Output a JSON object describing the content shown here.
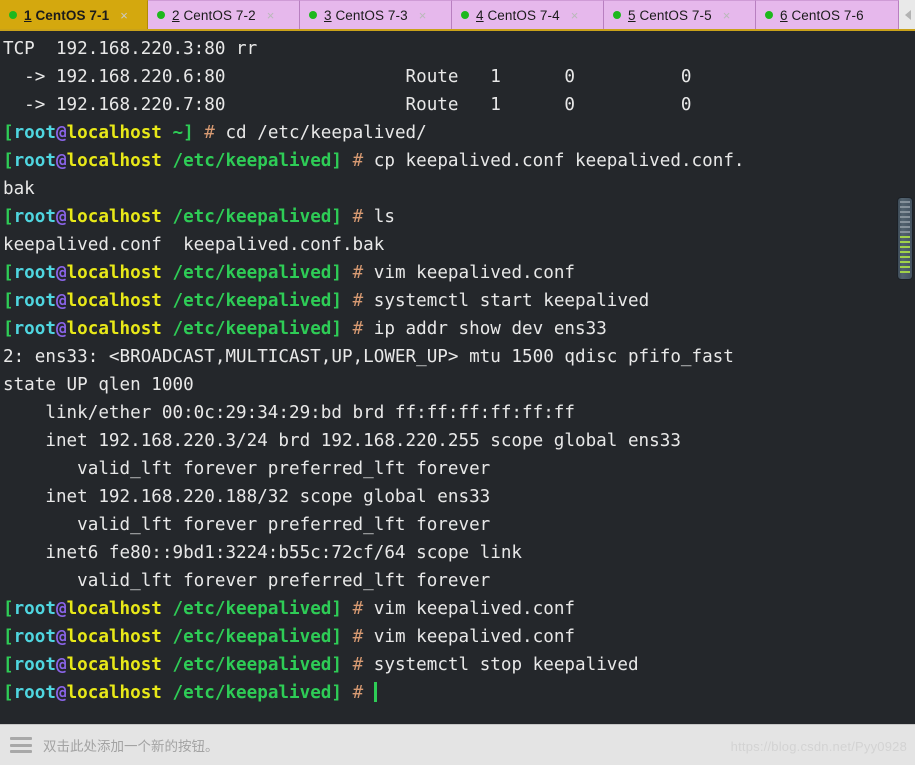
{
  "window": {
    "accent_active_tab": "#d4a80e",
    "accent_inactive_tab": "#e6b8ec",
    "terminal_background": "#24272b"
  },
  "tabbar": {
    "tabs": [
      {
        "num": "1",
        "name": "CentOS 7-1",
        "active": true,
        "status_dot": "green",
        "close_label": "×"
      },
      {
        "num": "2",
        "name": "CentOS 7-2",
        "active": false,
        "status_dot": "green",
        "close_label": "×"
      },
      {
        "num": "3",
        "name": "CentOS 7-3",
        "active": false,
        "status_dot": "green",
        "close_label": "×"
      },
      {
        "num": "4",
        "name": "CentOS 7-4",
        "active": false,
        "status_dot": "green",
        "close_label": "×"
      },
      {
        "num": "5",
        "name": "CentOS 7-5",
        "active": false,
        "status_dot": "green",
        "close_label": "×"
      },
      {
        "num": "6",
        "name": "CentOS 7-6",
        "active": false,
        "status_dot": "green",
        "close_label": ""
      }
    ],
    "nav_prev_icon": "chevron-left-icon",
    "nav_next_icon": "chevron-right-icon"
  },
  "prompt": {
    "user": "root",
    "at": "@",
    "host": "localhost",
    "bracket_open": "[",
    "bracket_close": "]",
    "path_home": "~",
    "path_keepalived": "/etc/keepalived",
    "sigil": "#"
  },
  "terminal": {
    "lines": [
      {
        "type": "out",
        "text": "TCP  192.168.220.3:80 rr"
      },
      {
        "type": "out",
        "text": "  -> 192.168.220.6:80                 Route   1      0          0"
      },
      {
        "type": "out",
        "text": "  -> 192.168.220.7:80                 Route   1      0          0"
      },
      {
        "type": "prompt",
        "path": "~",
        "command": "cd /etc/keepalived/"
      },
      {
        "type": "prompt",
        "path": "/etc/keepalived",
        "command": "cp keepalived.conf keepalived.conf."
      },
      {
        "type": "out",
        "text": "bak"
      },
      {
        "type": "prompt",
        "path": "/etc/keepalived",
        "command": "ls"
      },
      {
        "type": "out",
        "text": "keepalived.conf  keepalived.conf.bak"
      },
      {
        "type": "prompt",
        "path": "/etc/keepalived",
        "command": "vim keepalived.conf"
      },
      {
        "type": "prompt",
        "path": "/etc/keepalived",
        "command": "systemctl start keepalived"
      },
      {
        "type": "prompt",
        "path": "/etc/keepalived",
        "command": "ip addr show dev ens33"
      },
      {
        "type": "out",
        "text": "2: ens33: <BROADCAST,MULTICAST,UP,LOWER_UP> mtu 1500 qdisc pfifo_fast"
      },
      {
        "type": "out",
        "text": "state UP qlen 1000"
      },
      {
        "type": "out",
        "text": "    link/ether 00:0c:29:34:29:bd brd ff:ff:ff:ff:ff:ff"
      },
      {
        "type": "out",
        "text": "    inet 192.168.220.3/24 brd 192.168.220.255 scope global ens33"
      },
      {
        "type": "out",
        "text": "       valid_lft forever preferred_lft forever"
      },
      {
        "type": "out",
        "text": "    inet 192.168.220.188/32 scope global ens33"
      },
      {
        "type": "out",
        "text": "       valid_lft forever preferred_lft forever"
      },
      {
        "type": "out",
        "text": "    inet6 fe80::9bd1:3224:b55c:72cf/64 scope link"
      },
      {
        "type": "out",
        "text": "       valid_lft forever preferred_lft forever"
      },
      {
        "type": "prompt",
        "path": "/etc/keepalived",
        "command": "vim keepalived.conf"
      },
      {
        "type": "prompt",
        "path": "/etc/keepalived",
        "command": "vim keepalived.conf"
      },
      {
        "type": "prompt",
        "path": "/etc/keepalived",
        "command": "systemctl stop keepalived"
      },
      {
        "type": "prompt",
        "path": "/etc/keepalived",
        "command": "",
        "cursor": true
      }
    ],
    "scrollbar": {
      "thumb_top_pct": 24,
      "thumb_height_pct": 12
    }
  },
  "statusbar": {
    "menu_icon": "hamburger-icon",
    "hint": "双击此处添加一个新的按钮。",
    "watermark": "https://blog.csdn.net/Pyy0928"
  }
}
